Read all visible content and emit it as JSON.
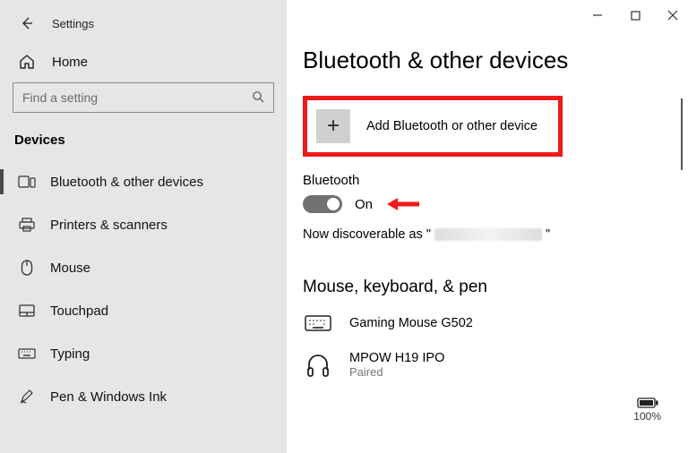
{
  "window": {
    "title": "Settings"
  },
  "sidebar": {
    "home_label": "Home",
    "search_placeholder": "Find a setting",
    "section_label": "Devices",
    "items": [
      {
        "label": "Bluetooth & other devices",
        "active": true
      },
      {
        "label": "Printers & scanners"
      },
      {
        "label": "Mouse"
      },
      {
        "label": "Touchpad"
      },
      {
        "label": "Typing"
      },
      {
        "label": "Pen & Windows Ink"
      }
    ]
  },
  "page": {
    "title": "Bluetooth & other devices",
    "add_device_label": "Add Bluetooth or other device",
    "bluetooth_label": "Bluetooth",
    "toggle_state": "On",
    "discoverable_prefix": "Now discoverable as \"",
    "discoverable_suffix": "\"",
    "device_section_label": "Mouse, keyboard, & pen",
    "devices": [
      {
        "name": "Gaming Mouse G502",
        "status": ""
      },
      {
        "name": "MPOW H19 IPO",
        "status": "Paired"
      }
    ],
    "battery_percent": "100%"
  }
}
